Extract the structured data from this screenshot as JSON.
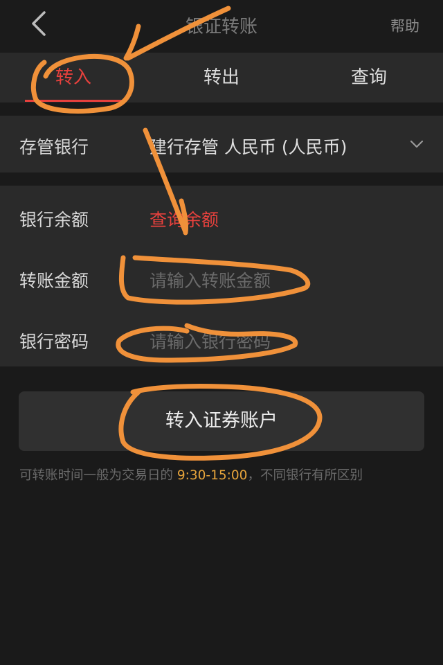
{
  "header": {
    "title": "银证转账",
    "help_label": "帮助",
    "back_icon": "chevron-left-icon"
  },
  "tabs": [
    {
      "label": "转入",
      "active": true
    },
    {
      "label": "转出",
      "active": false
    },
    {
      "label": "查询",
      "active": false
    }
  ],
  "custody_bank": {
    "label": "存管银行",
    "value": "建行存管 人民币 (人民币)",
    "icon": "chevron-down-icon"
  },
  "form": {
    "balance_label": "银行余额",
    "balance_link": "查询余额",
    "amount_label": "转账金额",
    "amount_placeholder": "请输入转账金额",
    "password_label": "银行密码",
    "password_placeholder": "请输入银行密码"
  },
  "submit_label": "转入证券账户",
  "note": {
    "prefix": "可转账时间一般为交易日的 ",
    "hours": "9:30-15:00",
    "suffix": "，不同银行有所区别"
  },
  "colors": {
    "accent_red": "#e8413d",
    "highlight_orange": "#e8a53b",
    "annotation_orange": "#f0913a"
  }
}
